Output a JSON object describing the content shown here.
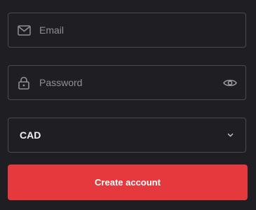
{
  "form": {
    "email": {
      "placeholder": "Email",
      "value": ""
    },
    "password": {
      "placeholder": "Password",
      "value": ""
    },
    "currency": {
      "selected": "CAD"
    },
    "submit_label": "Create account"
  },
  "icons": {
    "email": "mail-icon",
    "password": "lock-icon",
    "show_password": "eye-icon",
    "dropdown": "chevron-down-icon"
  },
  "colors": {
    "background": "#1f1f23",
    "field_border": "#4a4a50",
    "placeholder": "#8f8f95",
    "primary_button": "#e5393d"
  }
}
